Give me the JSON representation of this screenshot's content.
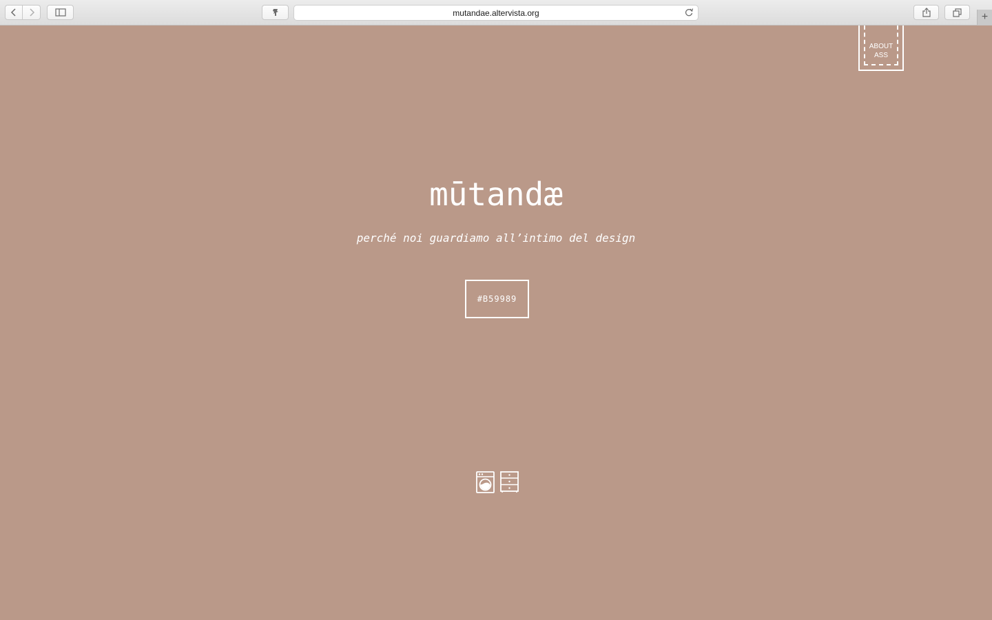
{
  "browser": {
    "url": "mutandae.altervista.org",
    "new_tab_label": "+"
  },
  "page": {
    "background_color": "#B59989",
    "about_tag": {
      "line1": "ABOUT",
      "line2": "ASS"
    },
    "title": "mūtandæ",
    "subtitle": "perché noi guardiamo all’intimo del design",
    "color_code": "#B59989",
    "bottom_icons": [
      "washing-machine-icon",
      "dresser-icon"
    ]
  }
}
